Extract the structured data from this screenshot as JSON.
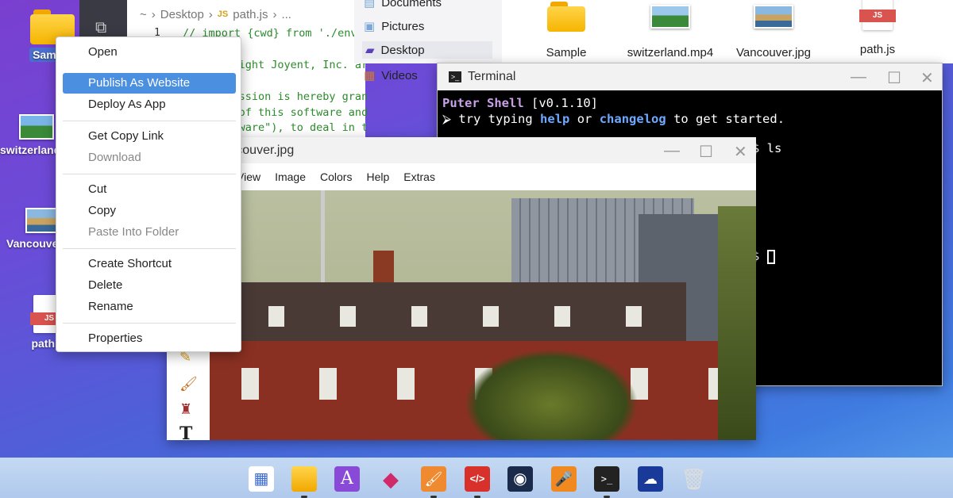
{
  "desktop": {
    "icons": [
      {
        "label": "Sample",
        "type": "folder"
      },
      {
        "label": "switzerland.mp4",
        "type": "video"
      },
      {
        "label": "Vancouver.jpg",
        "type": "image"
      },
      {
        "label": "path.js",
        "type": "js"
      }
    ],
    "js_badge": "JS"
  },
  "editor": {
    "breadcrumb": [
      "~",
      "Desktop",
      "path.js",
      "..."
    ],
    "js_badge": "JS",
    "line_number": "1",
    "lines": [
      "// import {cwd} from './env",
      "Copyright Joyent, Inc. ar",
      "",
      "Permission is hereby gran",
      "copy of this software and",
      "\"Software\"), to deal in t"
    ]
  },
  "file_manager": {
    "sidebar": [
      {
        "label": "Documents",
        "selected": false
      },
      {
        "label": "Pictures",
        "selected": false
      },
      {
        "label": "Desktop",
        "selected": true
      },
      {
        "label": "Videos",
        "selected": false
      }
    ],
    "files": [
      {
        "label": "Sample",
        "type": "folder"
      },
      {
        "label": "switzerland.mp4",
        "type": "video"
      },
      {
        "label": "Vancouver.jpg",
        "type": "image"
      },
      {
        "label": "path.js",
        "type": "js"
      }
    ]
  },
  "terminal": {
    "title": "Terminal",
    "shell_name": "Puter Shell",
    "version": "[v0.1.10]",
    "hint_prefix": "try typing",
    "hint_help": "help",
    "hint_or": "or",
    "hint_changelog": "changelog",
    "hint_suffix": "to get started.",
    "prompt_cmd": "$ ls",
    "prompt_end": "$"
  },
  "paint": {
    "title": "Vancouver.jpg",
    "menu": [
      "View",
      "Image",
      "Colors",
      "Help",
      "Extras"
    ]
  },
  "context_menu": {
    "items": [
      {
        "label": "Open",
        "state": "normal"
      },
      {
        "label": "Publish As Website",
        "state": "highlighted"
      },
      {
        "label": "Deploy As App",
        "state": "normal"
      },
      {
        "label": "Get Copy Link",
        "state": "normal"
      },
      {
        "label": "Download",
        "state": "disabled"
      },
      {
        "label": "Cut",
        "state": "normal"
      },
      {
        "label": "Copy",
        "state": "normal"
      },
      {
        "label": "Paste Into Folder",
        "state": "disabled"
      },
      {
        "label": "Create Shortcut",
        "state": "normal"
      },
      {
        "label": "Delete",
        "state": "normal"
      },
      {
        "label": "Rename",
        "state": "normal"
      },
      {
        "label": "Properties",
        "state": "normal"
      }
    ]
  },
  "taskbar": {
    "apps": [
      "app-launcher-icon",
      "file-explorer-icon",
      "text-editor-icon",
      "cubes-icon",
      "paint-brush-icon",
      "code-editor-icon",
      "camera-icon",
      "recorder-icon",
      "terminal-icon",
      "cloud-network-icon",
      "trash-icon"
    ],
    "text_editor_glyph": "A",
    "code_glyph": "</>",
    "terminal_glyph": ">_"
  },
  "colors": {
    "highlight": "#4b8fe0",
    "terminal_purple": "#c8a0e8",
    "terminal_blue": "#6ea8ff"
  }
}
